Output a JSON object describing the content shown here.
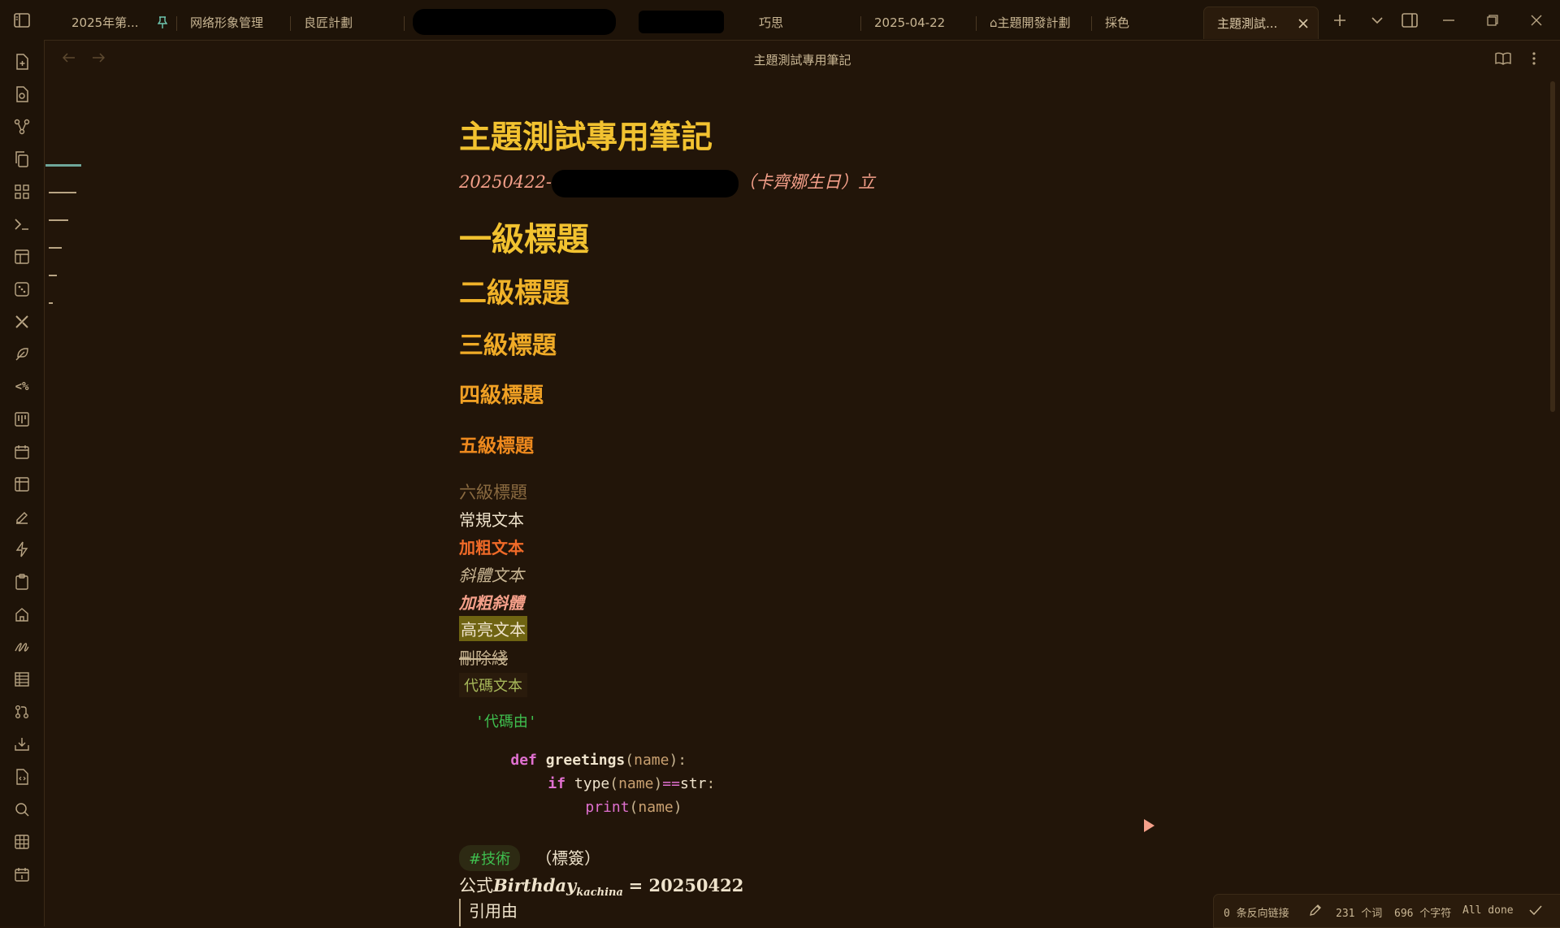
{
  "tabs": [
    {
      "label": "2025年第..."
    },
    {
      "label": "网络形象管理"
    },
    {
      "label": "良匠計劃"
    },
    {
      "label": "巧思"
    },
    {
      "label": "2025-04-22"
    },
    {
      "label": "⌂主題開發計劃"
    },
    {
      "label": "採色"
    },
    {
      "label": "主題測試..."
    }
  ],
  "view_header": {
    "title": "主題測試專用筆記"
  },
  "note": {
    "title": "主題測試專用筆記",
    "subtitle_prefix": "20250422-",
    "subtitle_suffix": "（卡齊娜生日）立",
    "h1": "一級標題",
    "h2": "二級標題",
    "h3": "三級標題",
    "h4": "四級標題",
    "h5": "五級標題",
    "h6": "六級標題",
    "normal": "常規文本",
    "bold": "加粗文本",
    "italic": "斜體文本",
    "bold_italic": "加粗斜體",
    "highlight": "高亮文本",
    "strike": "刪除綫",
    "inline_code": "代碼文本",
    "code_lines": {
      "l1": "'代碼由'",
      "l2_kw": "def",
      "l2_fn": "greetings",
      "l2_p1": "(",
      "l2_arg": "name",
      "l2_p2": "):",
      "l3_kw": "if",
      "l3_fn": "type",
      "l3_p1": "(",
      "l3_arg": "name",
      "l3_p2": ")",
      "l3_op": "==",
      "l3_t": "str",
      "l3_c": ":",
      "l4_fn": "print",
      "l4_p1": "(",
      "l4_arg": "name",
      "l4_p2": ")"
    },
    "tag": "#技術",
    "tag_note": "（標簽）",
    "formula_prefix": "公式",
    "formula_main": "Birthday",
    "formula_sub": "kachina",
    "formula_eq": "= 20250422",
    "quote": "引用由"
  },
  "status": {
    "backlinks": "0 条反向链接",
    "words": "231 个词",
    "chars": "696 个字符",
    "state": "All done"
  },
  "colors": {
    "background": "#221509",
    "title": "#f2c230",
    "h1": "#f2c230",
    "h2": "#f0b229",
    "h5": "#ef8a1e",
    "h6": "#8a6a40",
    "bold": "#f06a28",
    "italic": "#c9b693",
    "bold_italic": "#f5a08a",
    "highlight_bg": "#6f6412",
    "code_string": "#3fbf4f",
    "code_keyword": "#e070d0",
    "tag_text": "#3fbf4f"
  }
}
